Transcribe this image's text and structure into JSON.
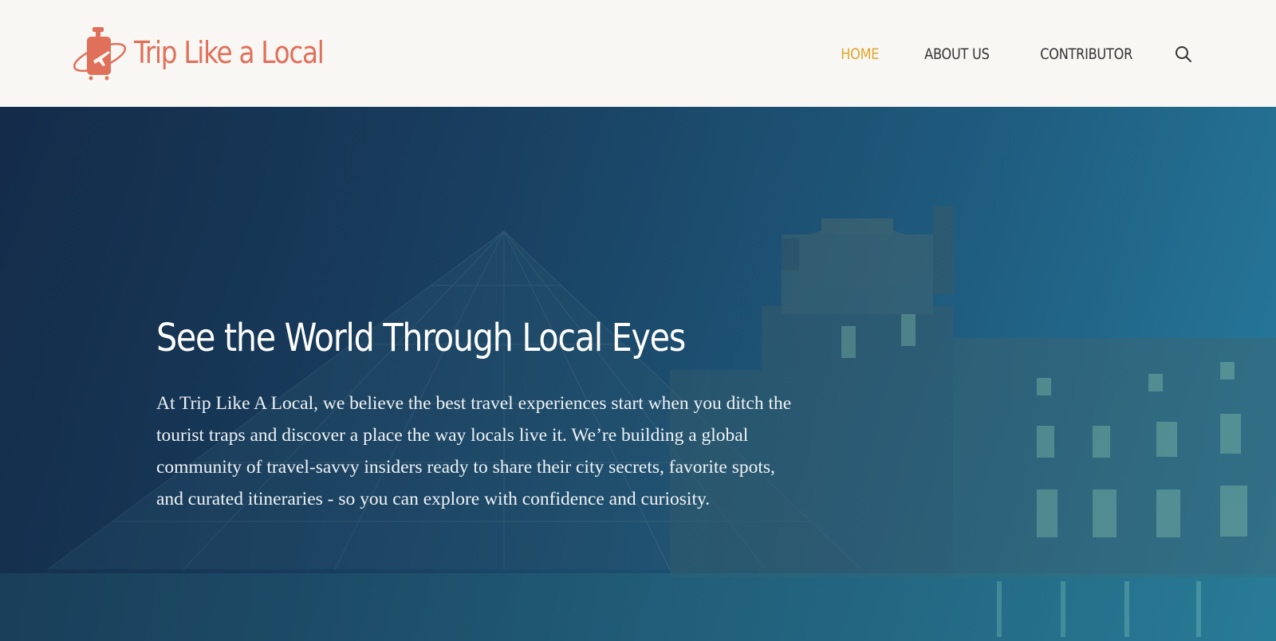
{
  "brand": {
    "name": "Trip Like a Local",
    "color": "#e0705a",
    "icon": "suitcase-airplane-icon"
  },
  "nav": {
    "items": [
      {
        "label": "HOME",
        "active": true
      },
      {
        "label": "ABOUT US",
        "active": false
      },
      {
        "label": "CONTRIBUTOR",
        "active": false
      }
    ],
    "search_icon": "search-icon",
    "active_color": "#e0a62a"
  },
  "hero": {
    "title": "See the World Through Local Eyes",
    "body": "At Trip Like A Local, we believe the best travel experiences start when you ditch the tourist traps and discover a place the way locals live it. We’re building a global community of travel-savvy insiders ready to share their city secrets, favorite spots, and curated itineraries - so you can explore with confidence and curiosity."
  }
}
